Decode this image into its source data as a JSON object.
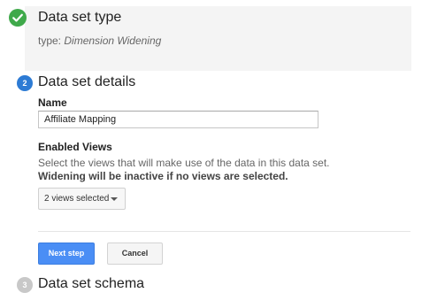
{
  "step1": {
    "title": "Data set type",
    "type_prefix": "type: ",
    "type_value": "Dimension Widening",
    "status_icon": "checkmark-icon",
    "status_color": "#3fa94a"
  },
  "step2": {
    "number": "2",
    "title": "Data set details",
    "name_label": "Name",
    "name_value": "Affiliate Mapping",
    "views_label": "Enabled Views",
    "views_description": "Select the views that will make use of the data in this data set.",
    "views_warning": "Widening will be inactive if no views are selected.",
    "views_selected": "2 views selected",
    "active_color": "#2d7bd4"
  },
  "actions": {
    "next_label": "Next step",
    "cancel_label": "Cancel",
    "primary_color": "#4a8ef5"
  },
  "step3": {
    "number": "3",
    "title": "Data set schema"
  }
}
